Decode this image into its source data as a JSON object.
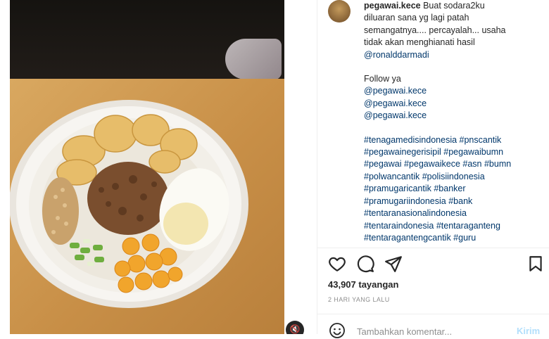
{
  "media": {
    "mute_icon": "speaker-muted-icon",
    "mute_glyph": "🔇"
  },
  "post": {
    "username": "pegawai.kece",
    "caption_lines": [
      "Buat sodara2ku",
      "diluaran sana yg lagi patah",
      "semangatnya.... percayalah... usaha",
      "tidak akan menghianati hasil"
    ],
    "mention": "@ronalddarmadi",
    "follow_label": "Follow ya",
    "follow_handles": [
      "@pegawai.kece",
      "@pegawai.kece",
      "@pegawai.kece"
    ],
    "hashtag_lines": [
      "#tenagamedisindonesia #pnscantik",
      "#pegawainegerisipil #pegawaibumn",
      "#pegawai #pegawaikece #asn #bumn",
      "#polwancantik #polisiindonesia",
      "#pramugaricantik #banker",
      "#pramugariindonesia #bank",
      "#tentaranasionalindonesia",
      "#tentaraindonesia #tentaraganteng",
      "#tentaragantengcantik #guru"
    ]
  },
  "actions": {
    "like_icon": "heart-icon",
    "comment_icon": "comment-icon",
    "share_icon": "send-icon",
    "save_icon": "bookmark-icon"
  },
  "stats": {
    "views": "43,907 tayangan",
    "time": "2 HARI YANG LALU"
  },
  "comment": {
    "emoji_icon": "emoji-icon",
    "placeholder": "Tambahkan komentar...",
    "post_label": "Kirim"
  },
  "colors": {
    "link": "#00376b",
    "text": "#262626",
    "muted": "#8e8e8e",
    "post_button": "#b2dffc"
  }
}
